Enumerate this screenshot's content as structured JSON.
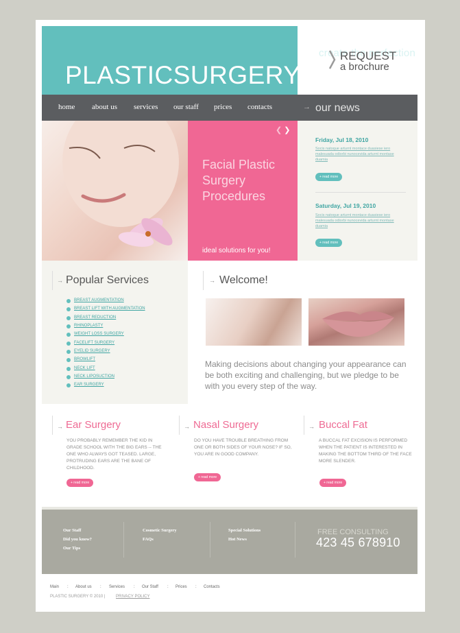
{
  "header": {
    "tagline": "create the perfection",
    "brand": "PLASTICSURGERY",
    "request_line1": "REQUEST",
    "request_line2": "a brochure"
  },
  "nav": {
    "items": [
      "home",
      "about us",
      "services",
      "our staff",
      "prices",
      "contacts"
    ],
    "news_title": "our news"
  },
  "hero": {
    "title": "Facial Plastic Surgery Procedures",
    "subtitle": "ideal solutions for you!"
  },
  "news": [
    {
      "date": "Friday, Jul 18, 2010",
      "text": "Socis natoque arturnt montace duasiese iero malesuada odiorbi nunocevida arturnt montase duamia",
      "button": "+ read more"
    },
    {
      "date": "Saturday, Jul 19, 2010",
      "text": "Socis natoque arturnt montace duasiese iero malesuada odiorbi nunocevida arturnt montase duamia",
      "button": "+ read more"
    }
  ],
  "services": {
    "title": "Popular Services",
    "items": [
      "BREAST AUGMENTATION",
      "BREAST LIFT WITH AUGMENTATION",
      "BREAST REDUCTION",
      "RHINOPLASTY",
      "WEIGHT LOSS SURGERY",
      "FACELIFT SURGERY",
      "EYELID SURGERY",
      "BROWLIFT",
      "NECK LIFT",
      "NECK LIPOSUCTION",
      "EAR SURGERY"
    ]
  },
  "welcome": {
    "title": "Welcome!",
    "text": "Making decisions about changing your appearance can be both exciting and challenging, but we pledge to be with you every step of the way."
  },
  "columns": [
    {
      "title": "Ear Surgery",
      "text": "YOU PROBABLY REMEMBER THE KID IN GRADE SCHOOL WITH THE BIG EARS -- THE ONE WHO ALWAYS GOT TEASED. LARGE, PROTRUDING EARS ARE THE BANE OF CHILDHOOD.",
      "button": "+ read more"
    },
    {
      "title": "Nasal Surgery",
      "text": "DO YOU HAVE TROUBLE BREATHING FROM ONE OR BOTH SIDES OF YOUR NOSE? IF SO, YOU ARE IN GOOD COMPANY.",
      "button": "+ read more"
    },
    {
      "title": "Buccal Fat",
      "text": "A BUCCAL FAT EXCISION IS PERFORMED WHEN THE PATIENT IS INTERESTED IN MAKING THE BOTTOM THIRD OF THE FACE MORE SLENDER.",
      "button": "+ read more"
    }
  ],
  "footer": {
    "col1": [
      "Our Staff",
      "Did you know?",
      "Our Tips"
    ],
    "col2": [
      "Cosmetic Surgery",
      "FAQs"
    ],
    "col3": [
      "Special Solutions",
      "Hot News"
    ],
    "consult_title": "FREE CONSULTING",
    "consult_phone": "423 45 678910"
  },
  "bottom": {
    "nav": [
      "Main",
      "About us",
      "Services",
      "Our Staff",
      "Prices",
      "Contacts"
    ],
    "separator": ":",
    "copyright": "PLASTIC SURGERY © 2010 |",
    "privacy": "PRIVACY POLICY"
  },
  "colors": {
    "teal": "#62bfbd",
    "pink": "#f06794",
    "dark": "#5b5d60",
    "gray": "#a9a9a0"
  }
}
